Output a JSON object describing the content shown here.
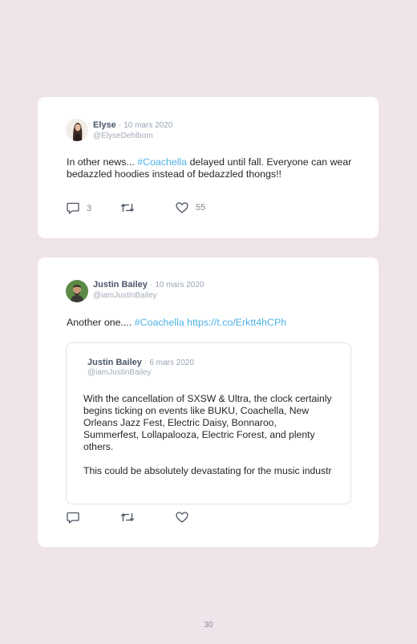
{
  "tweets": [
    {
      "author": "Elyse",
      "separator": "·",
      "date": "10 mars 2020",
      "handle": "@ElyseDehlbom",
      "text_pre": "In other news... ",
      "hashtag": "#Coachella",
      "text_post": " delayed until fall. Everyone can wear bedazzled hoodies instead of bedazzled thongs!!",
      "reply_count": "3",
      "like_count": "55"
    },
    {
      "author": "Justin Bailey",
      "separator": "·",
      "date": "10 mars 2020",
      "handle": "@iamJustinBailey",
      "text_pre": "Another one.... ",
      "hashtag": "#Coachella",
      "link": " https://t.co/Erktt4hCPh",
      "quoted": {
        "author": "Justin Bailey",
        "separator": "·",
        "date": "6 mars 2020",
        "handle": "@iamJustinBailey",
        "paragraph1": "With the cancellation of SXSW & Ultra, the clock certainly begins ticking on events like BUKU, Coachella, New Orleans Jazz Fest, Electric Daisy, Bonnaroo, Summerfest, Lollapalooza, Electric Forest, and plenty others.",
        "paragraph2": "This could be absolutely devastating for the music industr"
      }
    }
  ],
  "page_number": "30",
  "colors": {
    "background": "#efe4ea",
    "hashtag": "#4fb3e6",
    "card": "#ffffff"
  },
  "icons": [
    "reply-icon",
    "retweet-icon",
    "like-icon"
  ]
}
